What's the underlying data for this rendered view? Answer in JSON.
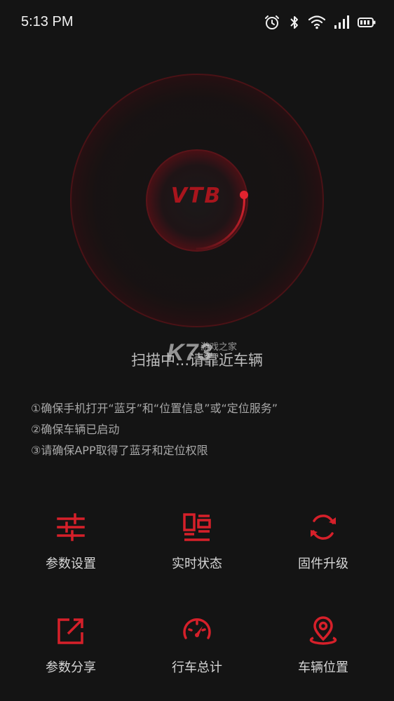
{
  "status_bar": {
    "time": "5:13 PM",
    "icons": [
      "alarm-icon",
      "bluetooth-icon",
      "wifi-icon",
      "signal-icon",
      "battery-icon"
    ]
  },
  "logo": {
    "text": "VTB"
  },
  "watermark": {
    "big": "K73",
    "small": "游戏之家",
    "com": ".com"
  },
  "scan": {
    "text": "扫描中...请靠近车辆"
  },
  "tips": [
    "①确保手机打开“蓝牙”和“位置信息”或“定位服务”",
    "②确保车辆已启动",
    "③请确保APP取得了蓝牙和定位权限"
  ],
  "menu": [
    {
      "label": "参数设置",
      "icon": "sliders-icon"
    },
    {
      "label": "实时状态",
      "icon": "status-panel-icon"
    },
    {
      "label": "固件升级",
      "icon": "refresh-icon"
    },
    {
      "label": "参数分享",
      "icon": "share-icon"
    },
    {
      "label": "行车总计",
      "icon": "speedometer-icon"
    },
    {
      "label": "车辆位置",
      "icon": "location-pin-icon"
    }
  ],
  "colors": {
    "accent": "#d6202a",
    "background": "#141414"
  }
}
